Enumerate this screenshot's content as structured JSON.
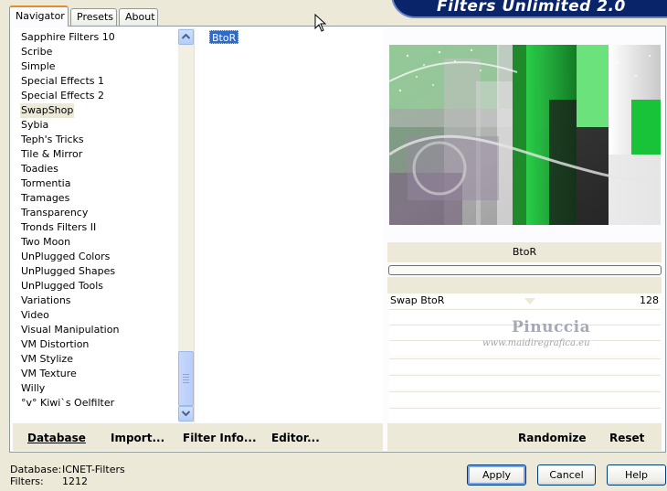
{
  "app": {
    "title": "Filters Unlimited 2.0"
  },
  "tabs": [
    {
      "label": "Navigator",
      "active": true
    },
    {
      "label": "Presets",
      "active": false
    },
    {
      "label": "About",
      "active": false
    }
  ],
  "categories": {
    "items": [
      "Sapphire Filters 10",
      "Scribe",
      "Simple",
      "Special Effects 1",
      "Special Effects 2",
      "SwapShop",
      "Sybia",
      "Teph's Tricks",
      "Tile & Mirror",
      "Toadies",
      "Tormentia",
      "Tramages",
      "Transparency",
      "Tronds Filters II",
      "Two Moon",
      "UnPlugged Colors",
      "UnPlugged Shapes",
      "UnPlugged Tools",
      "Variations",
      "Video",
      "Visual Manipulation",
      "VM Distortion",
      "VM Stylize",
      "VM Texture",
      "Willy",
      "°v° Kiwi`s Oelfilter"
    ],
    "selected": "SwapShop"
  },
  "filters": {
    "items": [
      "BtoR"
    ],
    "selected": "BtoR"
  },
  "preview": {
    "filter_name": "BtoR"
  },
  "parameters": [
    {
      "label": "Swap BtoR",
      "value": "128"
    }
  ],
  "watermark": {
    "line1": "Pinuccia",
    "line2": "www.maidiregrafica.eu"
  },
  "left_buttons": {
    "database": "Database",
    "import": "Import...",
    "filter_info": "Filter Info...",
    "editor": "Editor..."
  },
  "right_buttons": {
    "randomize": "Randomize",
    "reset": "Reset"
  },
  "status": {
    "database_label": "Database:",
    "database_value": "ICNET-Filters",
    "filters_label": "Filters:",
    "filters_value": "1212"
  },
  "dialog_buttons": {
    "apply": "Apply",
    "cancel": "Cancel",
    "help": "Help"
  },
  "colors": {
    "selection": "#316ac5",
    "banner": "#0a246a",
    "dialog_bg": "#ece9d8"
  }
}
